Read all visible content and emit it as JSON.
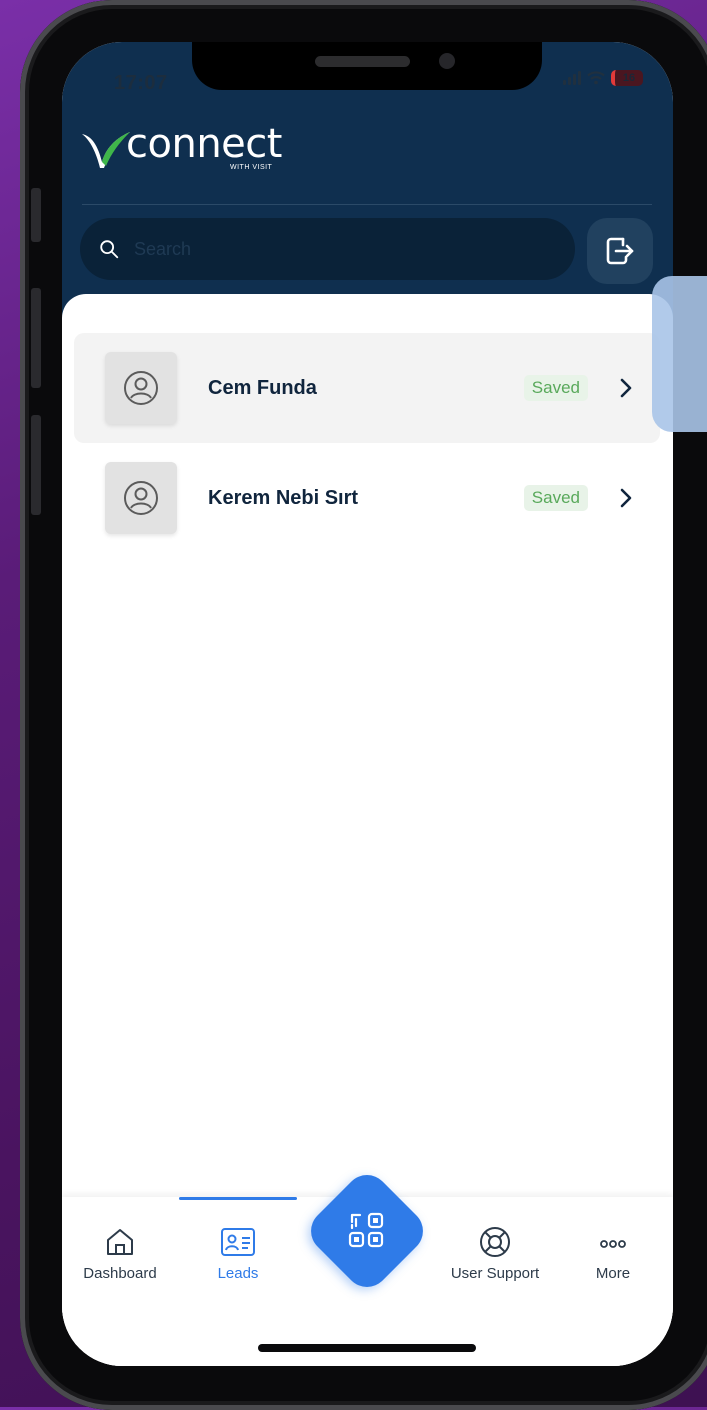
{
  "status_bar": {
    "time": "17:07",
    "battery": "16"
  },
  "brand": {
    "name": "connect",
    "tagline": "WITH VISIT"
  },
  "search": {
    "placeholder": "Search"
  },
  "leads": [
    {
      "name": "Cem Funda",
      "status": "Saved"
    },
    {
      "name": "Kerem Nebi Sırt",
      "status": "Saved"
    }
  ],
  "tabs": [
    {
      "label": "Dashboard",
      "icon": "home-icon"
    },
    {
      "label": "Leads",
      "icon": "contact-card-icon"
    },
    {
      "label": "User Support",
      "icon": "lifebuoy-icon"
    },
    {
      "label": "More",
      "icon": "more-dots-icon"
    }
  ],
  "colors": {
    "header": "#0f2f4f",
    "accent": "#2f7be8",
    "saved_badge_bg": "#e8f3e8",
    "saved_badge_text": "#59a95b"
  }
}
